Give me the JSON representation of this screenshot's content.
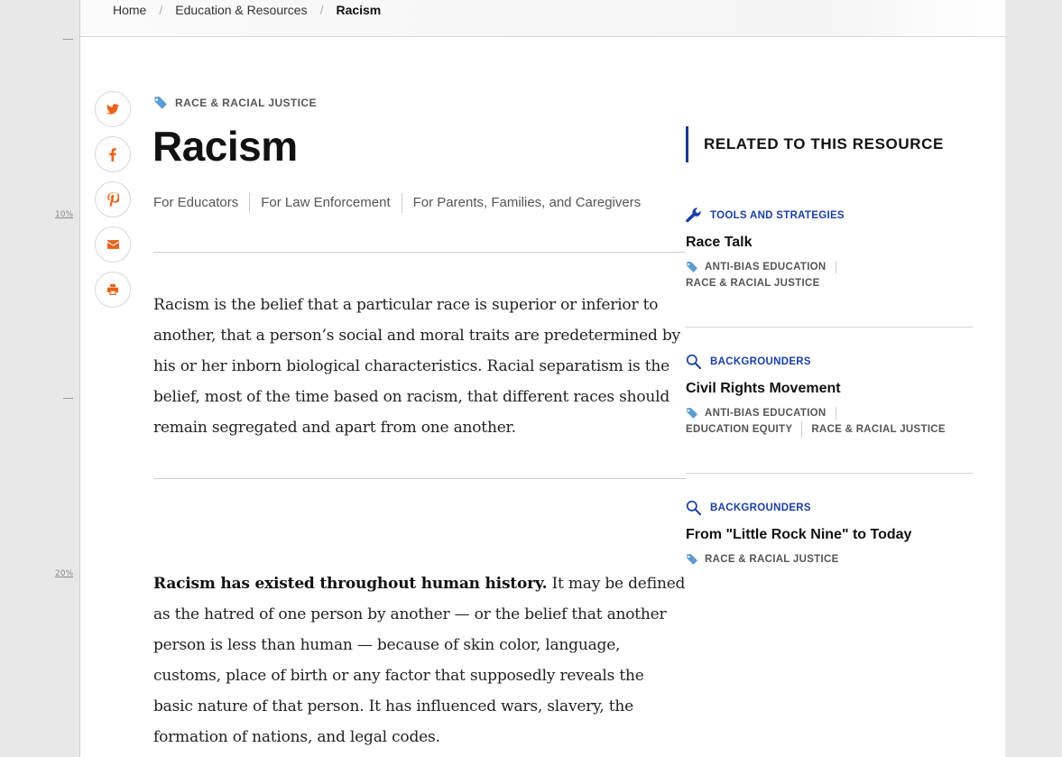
{
  "gutter": {
    "markers": [
      "10%",
      "20%"
    ]
  },
  "breadcrumb": {
    "items": [
      "Home",
      "Education & Resources",
      "Racism"
    ],
    "separator": "/"
  },
  "share": {
    "icons": [
      "twitter-icon",
      "facebook-icon",
      "pinterest-icon",
      "email-icon",
      "print-icon"
    ],
    "color": "#e8631a"
  },
  "article": {
    "topic_tag": "RACE & RACIAL JUSTICE",
    "title": "Racism",
    "audiences": [
      "For Educators",
      "For Law Enforcement",
      "For Parents, Families, and Caregivers"
    ],
    "intro": "Racism is the belief that a particular race is superior or inferior to another, that a person’s social and moral traits are predetermined by his or her inborn biological characteristics. Racial separatism is the belief, most of the time based on racism, that different races should remain segregated and apart from one another.",
    "lead_bold": "Racism has existed throughout human history.",
    "lead_rest": " It may be defined as the hatred of one person by another — or the belief that another person is less than human — because of skin color, language, customs, place of birth or any factor that supposedly reveals the basic nature of that person. It has influenced wars, slavery, the formation of nations, and legal codes."
  },
  "related": {
    "heading": "RELATED TO THIS RESOURCE",
    "accent": "#1a3a8c",
    "cards": [
      {
        "type": "TOOLS AND STRATEGIES",
        "icon": "wrench-icon",
        "title": "Race Talk",
        "tags": [
          "ANTI-BIAS EDUCATION",
          "RACE & RACIAL JUSTICE"
        ]
      },
      {
        "type": "BACKGROUNDERS",
        "icon": "magnifier-icon",
        "title": "Civil Rights Movement",
        "tags": [
          "ANTI-BIAS EDUCATION",
          "EDUCATION EQUITY",
          "RACE & RACIAL JUSTICE"
        ]
      },
      {
        "type": "BACKGROUNDERS",
        "icon": "magnifier-icon",
        "title": "From \"Little Rock Nine\" to Today",
        "tags": [
          "RACE & RACIAL JUSTICE"
        ]
      }
    ]
  }
}
